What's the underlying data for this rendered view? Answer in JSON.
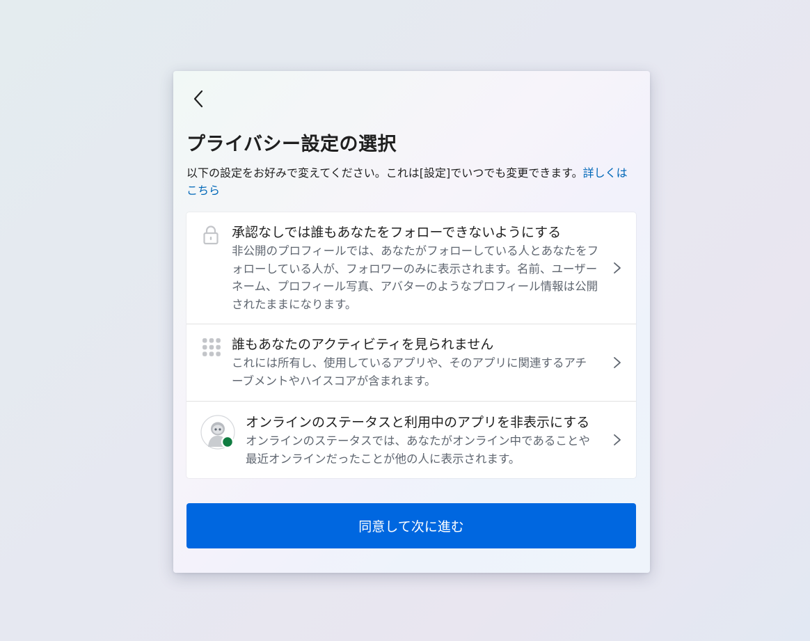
{
  "dialog": {
    "title": "プライバシー設定の選択",
    "description": "以下の設定をお好みで変えてください。これは[設定]でいつでも変更できます。",
    "learn_more_link": "詳しくはこちら"
  },
  "settings": [
    {
      "icon": "lock-icon",
      "title": "承認なしでは誰もあなたをフォローできないようにする",
      "body": "非公開のプロフィールでは、あなたがフォローしている人とあなたをフォローしている人が、フォロワーのみに表示されます。名前、ユーザーネーム、プロフィール写真、アバターのようなプロフィール情報は公開されたままになります。"
    },
    {
      "icon": "apps-grid-icon",
      "title": "誰もあなたのアクティビティを見られません",
      "body": "これには所有し、使用しているアプリや、そのアプリに関連するアチーブメントやハイスコアが含まれます。"
    },
    {
      "icon": "avatar-online-icon",
      "title": "オンラインのステータスと利用中のアプリを非表示にする",
      "body": "オンラインのステータスでは、あなたがオンライン中であることや最近オンラインだったことが他の人に表示されます。"
    }
  ],
  "actions": {
    "agree_label": "同意して次に進む"
  },
  "colors": {
    "accent": "#0067e0",
    "link": "#0067b8",
    "online_status": "#107c41"
  }
}
